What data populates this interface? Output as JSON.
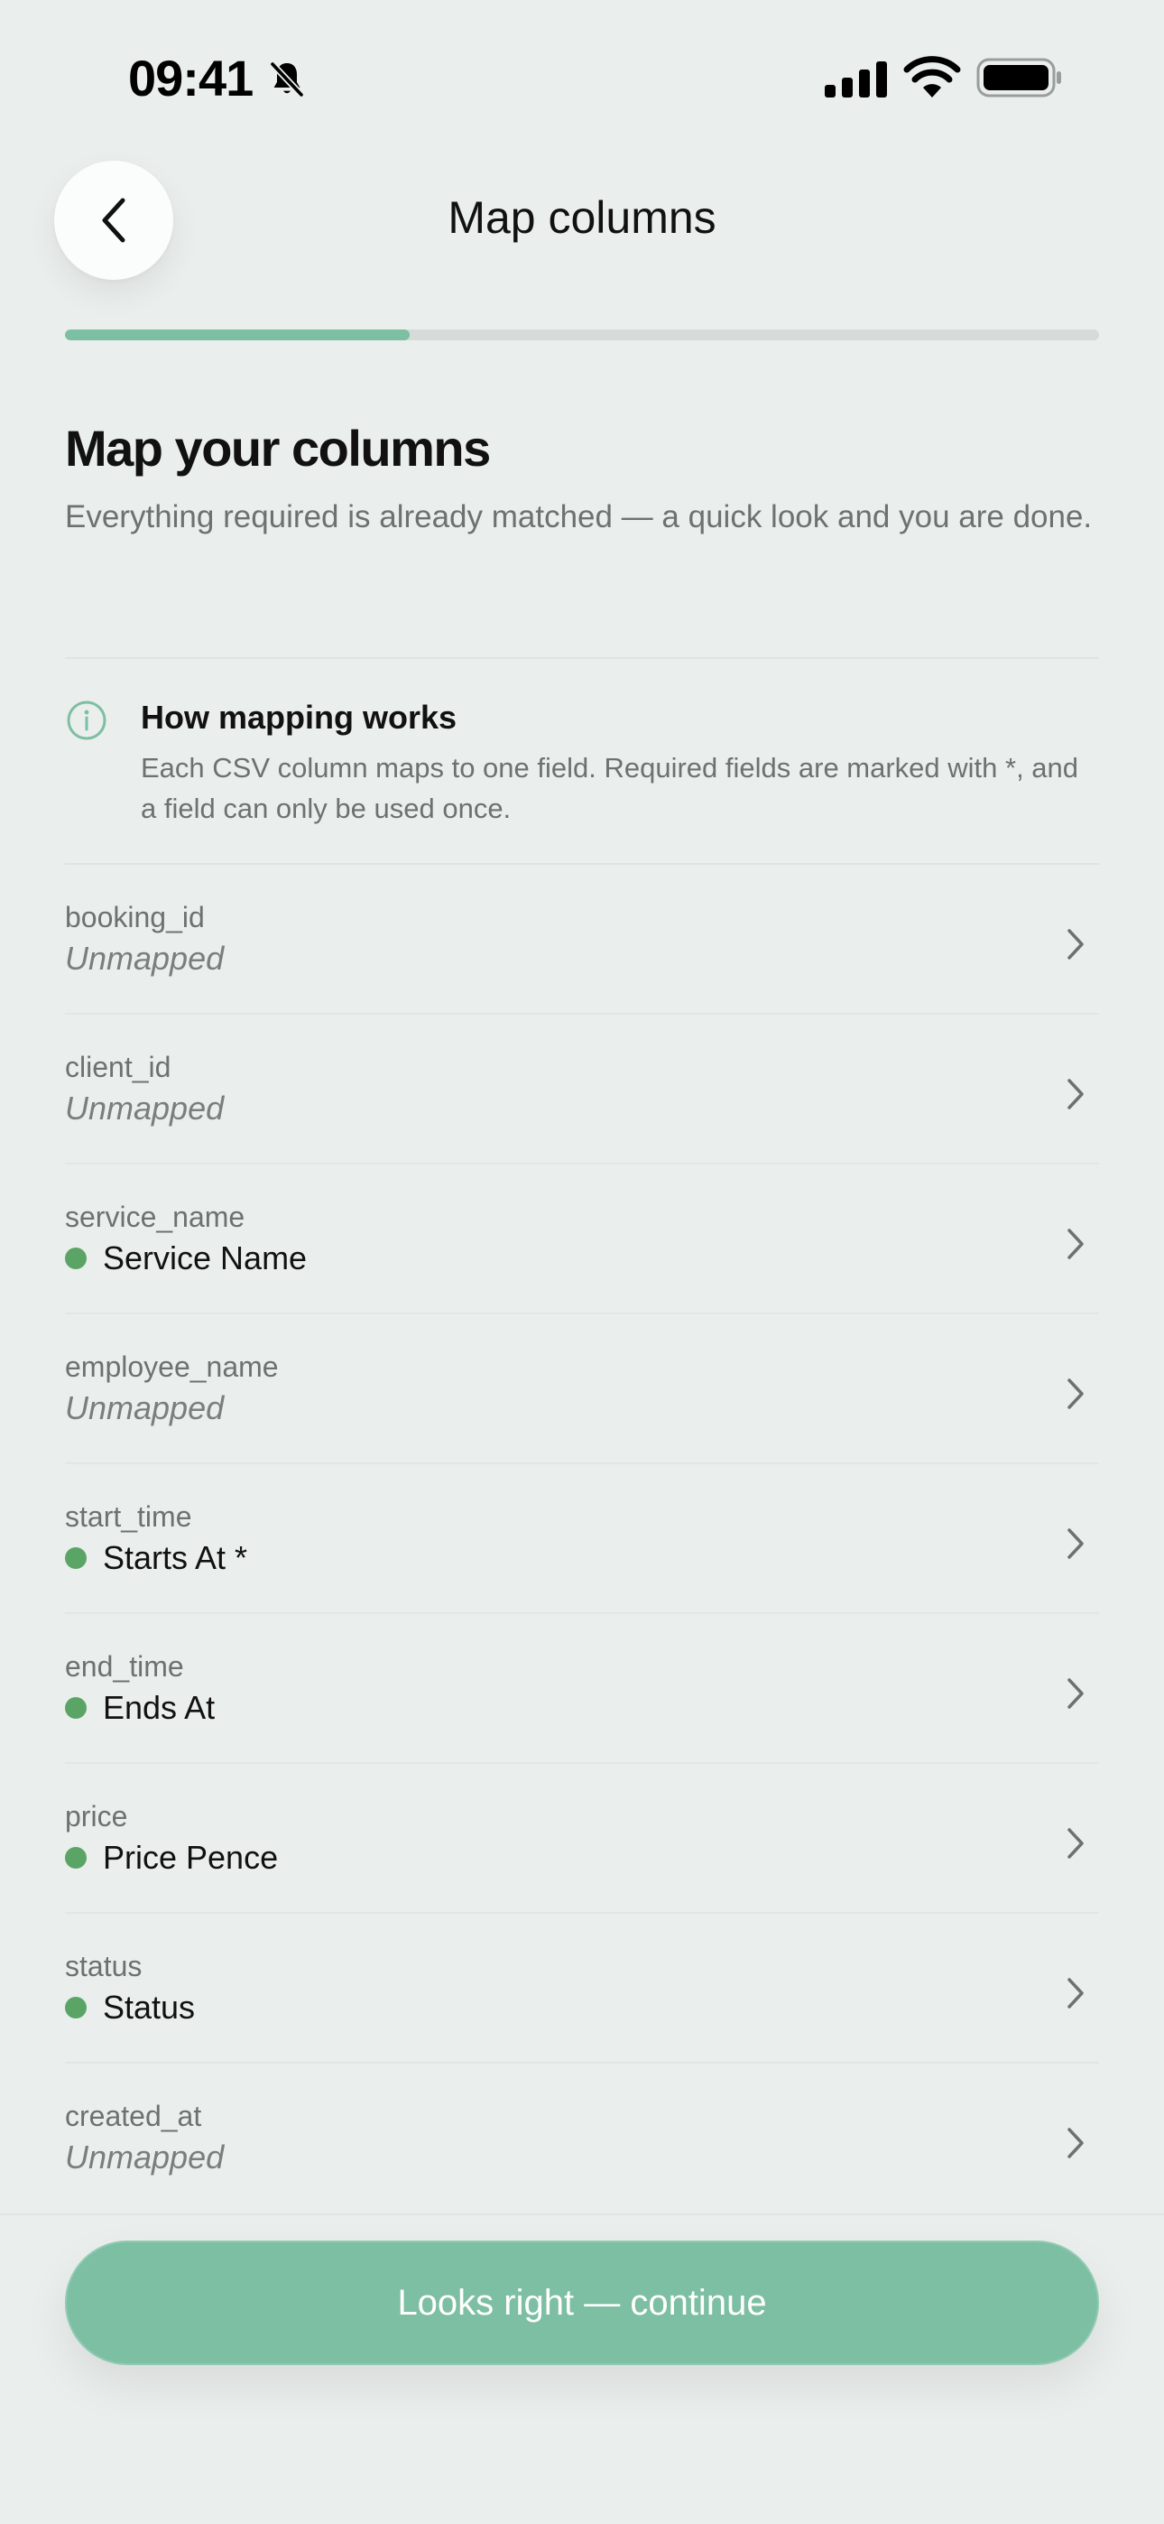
{
  "status_bar": {
    "time": "09:41",
    "icons": [
      "bell-slash-icon",
      "signal-icon",
      "wifi-icon",
      "battery-icon"
    ]
  },
  "nav": {
    "back_icon": "chevron-left-icon",
    "title": "Map columns"
  },
  "progress": {
    "fraction": 0.333,
    "color": "#7dbfa3"
  },
  "header": {
    "title": "Map your columns",
    "subtitle": "Everything required is already matched — a quick look and you are done."
  },
  "info": {
    "icon": "info-icon",
    "title": "How mapping works",
    "body": "Each CSV column maps to one field. Required fields are marked with *, and a field can only be used once."
  },
  "rows": [
    {
      "column": "booking_id",
      "field": "Unmapped",
      "mapped": false
    },
    {
      "column": "client_id",
      "field": "Unmapped",
      "mapped": false
    },
    {
      "column": "service_name",
      "field": "Service Name",
      "mapped": true
    },
    {
      "column": "employee_name",
      "field": "Unmapped",
      "mapped": false
    },
    {
      "column": "start_time",
      "field": "Starts At *",
      "mapped": true
    },
    {
      "column": "end_time",
      "field": "Ends At",
      "mapped": true
    },
    {
      "column": "price",
      "field": "Price Pence",
      "mapped": true
    },
    {
      "column": "status",
      "field": "Status",
      "mapped": true
    },
    {
      "column": "created_at",
      "field": "Unmapped",
      "mapped": false
    }
  ],
  "cta": {
    "label": "Looks right — continue"
  },
  "colors": {
    "accent": "#7dbfa3",
    "mapped_dot": "#5aa565",
    "background": "#eaeeed"
  }
}
